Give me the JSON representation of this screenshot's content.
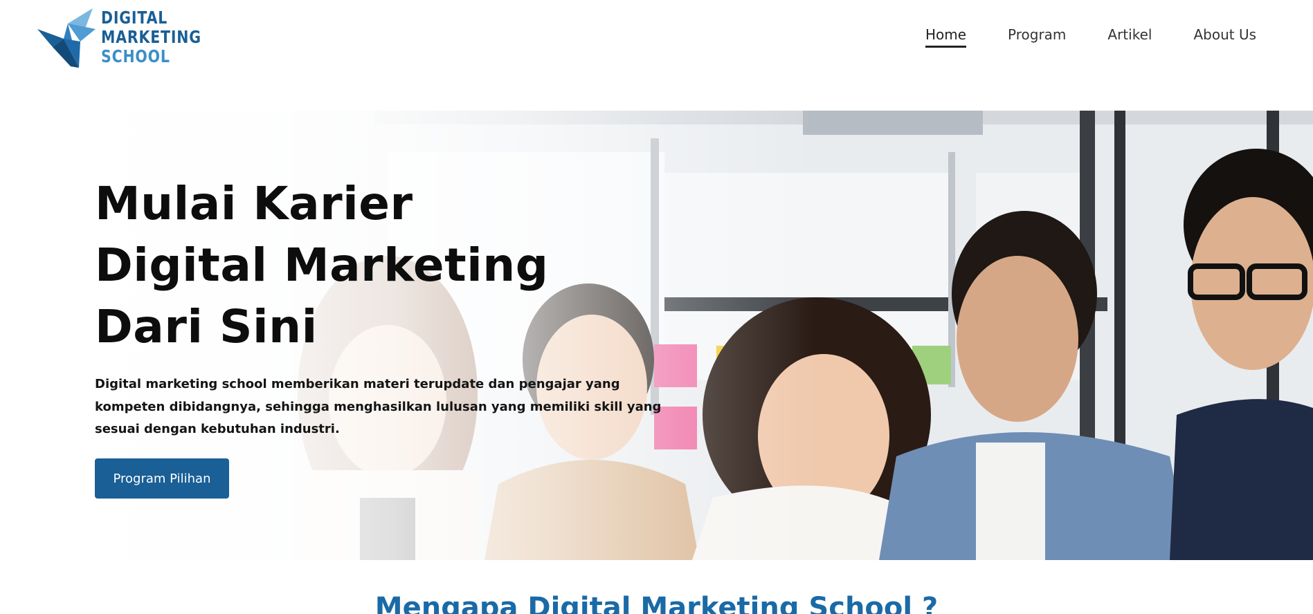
{
  "brand": {
    "logo_lines": [
      "DIGITAL",
      "MARKETING",
      "SCHOOL"
    ],
    "logo_icon": "origami-bird-icon",
    "colors": {
      "primary": "#1a5f96",
      "secondary": "#3b8fc7",
      "accent_light": "#7bb7e0"
    }
  },
  "nav": {
    "items": [
      {
        "label": "Home",
        "active": true
      },
      {
        "label": "Program",
        "active": false
      },
      {
        "label": "Artikel",
        "active": false
      },
      {
        "label": "About Us",
        "active": false
      }
    ]
  },
  "hero": {
    "title_lines": [
      "Mulai Karier",
      "Digital Marketing",
      "Dari Sini"
    ],
    "description": "Digital marketing school memberikan materi terupdate dan pengajar yang kompeten dibidangnya, sehingga menghasilkan lulusan yang memiliki skill yang sesuai dengan kebutuhan industri.",
    "cta_label": "Program Pilihan",
    "image": "group-of-young-professionals-photo"
  },
  "section": {
    "title": "Mengapa Digital Marketing School ?"
  }
}
